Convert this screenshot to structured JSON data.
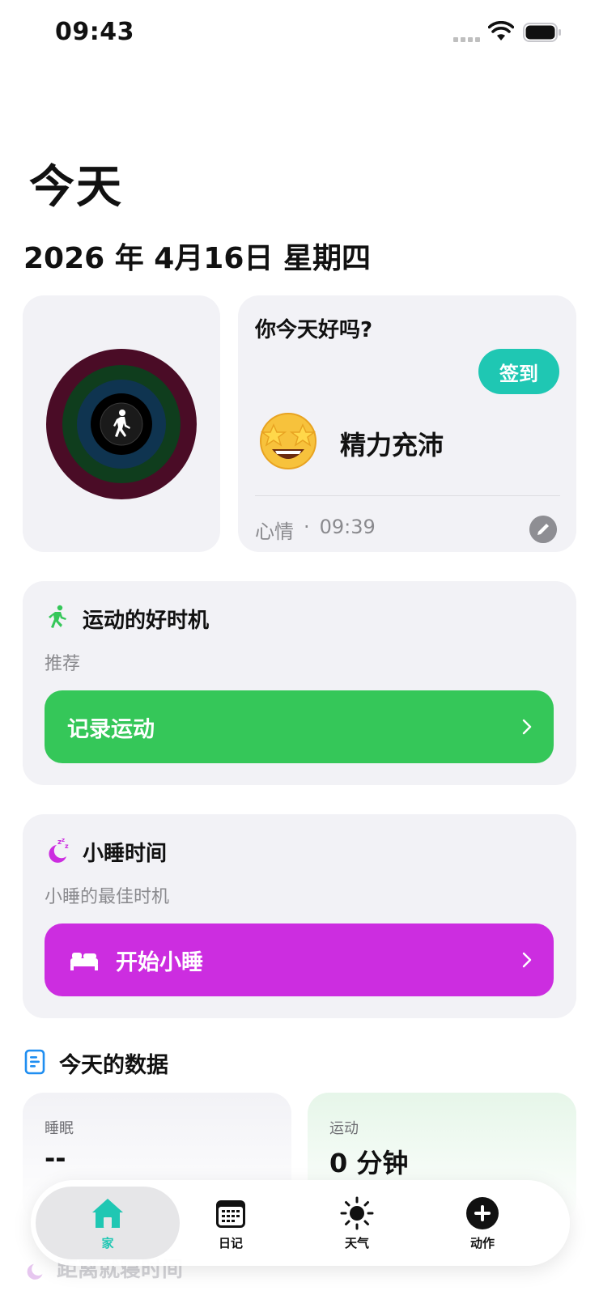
{
  "status_bar": {
    "time": "09:43"
  },
  "header": {
    "title": "今天",
    "date": "2026 年 4月16日 星期四"
  },
  "mood": {
    "question": "你今天好吗?",
    "checkin_label": "签到",
    "state": "精力充沛",
    "category": "心情",
    "separator": "·",
    "time": "09:39"
  },
  "exercise": {
    "title": "运动的好时机",
    "subtitle": "推荐",
    "action_label": "记录运动",
    "accent": "#35c759"
  },
  "nap": {
    "title": "小睡时间",
    "subtitle": "小睡的最佳时机",
    "action_label": "开始小睡",
    "accent": "#cc2de0"
  },
  "today_data": {
    "title": "今天的数据",
    "stats": [
      {
        "label": "睡眠",
        "value": "--"
      },
      {
        "label": "运动",
        "value": "0 分钟"
      }
    ]
  },
  "partial_section": {
    "title": "距离就寝时间"
  },
  "tab_bar": {
    "tabs": [
      {
        "label": "家",
        "icon": "home-icon",
        "active": true
      },
      {
        "label": "日记",
        "icon": "calendar-icon",
        "active": false
      },
      {
        "label": "天气",
        "icon": "sun-icon",
        "active": false
      },
      {
        "label": "动作",
        "icon": "plus-circle-icon",
        "active": false
      }
    ],
    "active_color": "#1fc7b3"
  }
}
